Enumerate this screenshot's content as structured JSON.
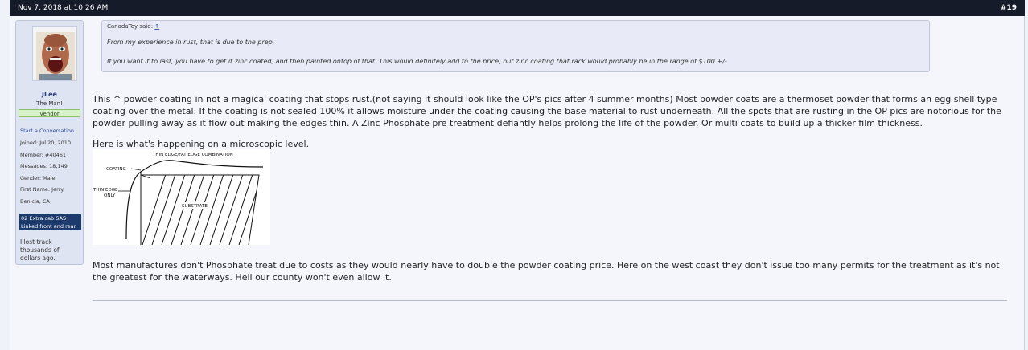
{
  "header": {
    "date": "Nov 7, 2018 at 10:26 AM",
    "post_number": "#19"
  },
  "user": {
    "name": "JLee",
    "title": "The Man!",
    "banner": "Vendor",
    "start_conversation": "Start a Conversation",
    "joined": "Joined: Jul 20, 2010",
    "member": "Member: #40461",
    "messages": "Messages: 18,149",
    "gender": "Gender: Male",
    "first_name": "First Name: Jerry",
    "location": "Benicia, CA",
    "signature_box_line1": "02 Extra cab SAS",
    "signature_box_line2": "Linked front and rear",
    "signature_text": "I lost track thousands of dollars ago."
  },
  "quote": {
    "author": "CanadaToy said:",
    "arrow": "↑",
    "line1": "From my experience in rust, that is due to the prep.",
    "line2": "If you want it to last, you have to get it zinc coated, and then painted ontop of that. This would definitely add to the price, but zinc coating that rack would probably be in the range of $100 +/-"
  },
  "post": {
    "paragraph1": "This ^ powder coating in not a magical coating that stops rust.(not saying it should look like the OP's pics after 4 summer months) Most powder coats are a thermoset powder that forms an egg shell type coating over the metal. If the coating is not sealed 100% it allows moisture under the coating causing the base material to rust underneath. All the spots that are rusting in the OP pics are notorious for the powder pulling away as it flow out making the edges thin. A Zinc Phosphate pre treatment defiantly helps prolong the life of the powder. Or multi coats to build up a thicker film thickness.",
    "microscopic_line": "Here is what's happening on a microscopic level.",
    "paragraph2": "Most manufactures don't Phosphate treat due to costs as they would nearly have to double the powder coating price. Here on the west coast they don't issue too many permits for the treatment as it's not the greatest for the waterways. Hell our county won't even allow it."
  },
  "diagram": {
    "title": "THIN EDGE/FAT EDGE COMBINATION",
    "coating": "COATING",
    "thin_edge_1": "THIN EDGE",
    "thin_edge_2": "ONLY",
    "substrate": "SUBSTRATE"
  },
  "colors": {
    "topbar": "#161b29",
    "sidebar": "#dfe4f2",
    "vendor_banner": "#daf2c9",
    "signature_box": "#1d3a6c"
  }
}
